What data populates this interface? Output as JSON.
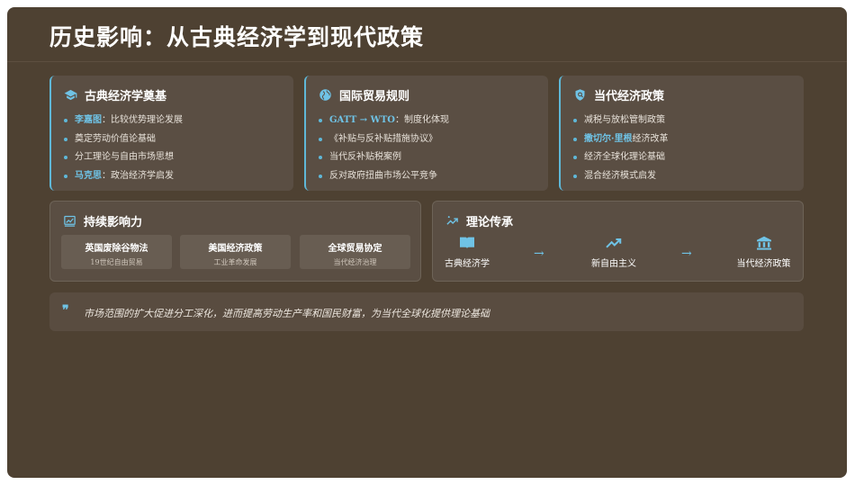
{
  "title": "历史影响：从古典经济学到现代政策",
  "cards": {
    "classical": {
      "title": "古典经济学奠基",
      "icon": "graduation-cap-icon",
      "items": [
        {
          "hl": "李嘉图",
          "text": "：比较优势理论发展"
        },
        {
          "hl": "",
          "text": "奠定劳动价值论基础"
        },
        {
          "hl": "",
          "text": "分工理论与自由市场思想"
        },
        {
          "hl": "马克思",
          "text": "：政治经济学启发"
        }
      ]
    },
    "trade": {
      "title": "国际贸易规则",
      "icon": "globe-icon",
      "items": [
        {
          "hl": "GATT → WTO",
          "text": "：制度化体现"
        },
        {
          "hl": "",
          "text": "《补贴与反补贴措施协议》"
        },
        {
          "hl": "",
          "text": "当代反补贴税案例"
        },
        {
          "hl": "",
          "text": "反对政府扭曲市场公平竞争"
        }
      ]
    },
    "policy": {
      "title": "当代经济政策",
      "icon": "shield-icon",
      "items": [
        {
          "hl": "",
          "text": "减税与放松管制政策"
        },
        {
          "hl": "撒切尔·里根",
          "text": "经济改革"
        },
        {
          "hl": "",
          "text": "经济全球化理论基础"
        },
        {
          "hl": "",
          "text": "混合经济模式启发"
        }
      ]
    }
  },
  "influence": {
    "title": "持续影响力",
    "icon": "chart-icon",
    "boxes": [
      {
        "title": "英国废除谷物法",
        "sub": "19世纪自由贸易"
      },
      {
        "title": "美国经济政策",
        "sub": "工业革命发展"
      },
      {
        "title": "全球贸易协定",
        "sub": "当代经济治理"
      }
    ]
  },
  "legacy": {
    "title": "理论传承",
    "icon": "sparkle-trend-icon",
    "nodes": [
      {
        "label": "古典经济学",
        "icon": "book-icon"
      },
      {
        "label": "新自由主义",
        "icon": "trend-up-icon"
      },
      {
        "label": "当代经济政策",
        "icon": "institution-icon"
      }
    ],
    "arrow": "→"
  },
  "quote": {
    "mark": "❞",
    "text": "市场范围的扩大促进分工深化，进而提高劳动生产率和国民财富，为当代全球化提供理论基础"
  },
  "colors": {
    "background": "#4e4132",
    "card": "#5a4e43",
    "accent": "#5fb8d8"
  }
}
